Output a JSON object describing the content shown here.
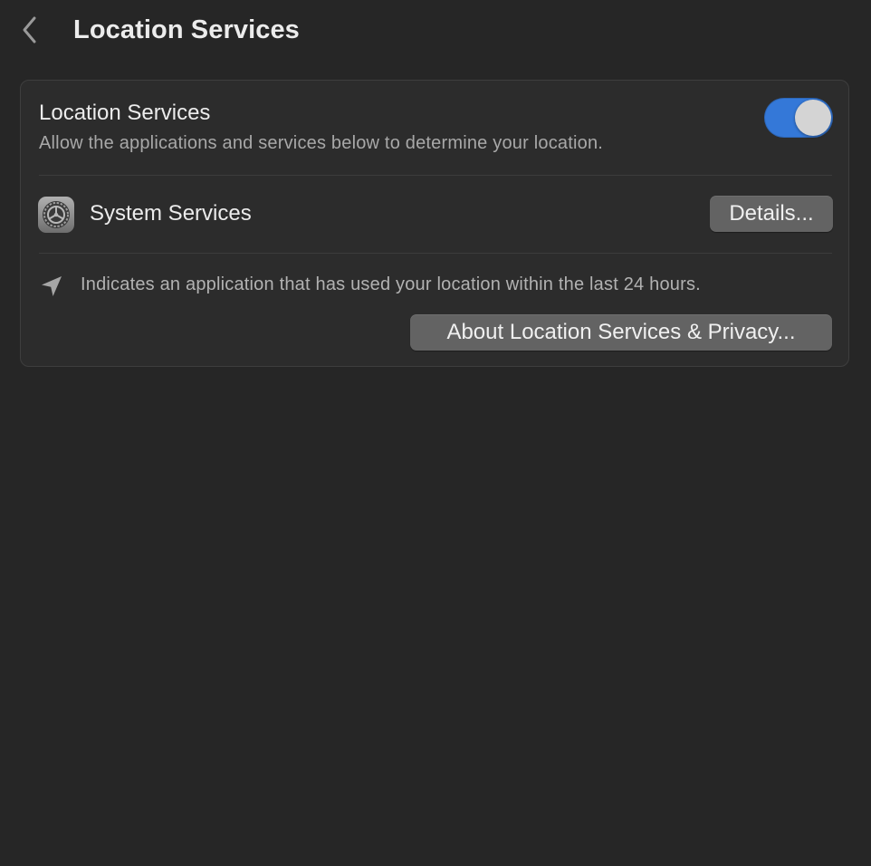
{
  "header": {
    "title": "Location Services",
    "back_icon": "chevron-left-icon"
  },
  "location_services": {
    "title": "Location Services",
    "subtitle": "Allow the applications and services below to determine your location.",
    "enabled": true,
    "toggle_color": "#3478d8"
  },
  "system_services": {
    "icon": "system-settings-gear-icon",
    "label": "System Services",
    "details_label": "Details..."
  },
  "legend": {
    "icon": "location-arrow-icon",
    "text": "Indicates an application that has used your location within the last 24 hours."
  },
  "about_button_label": "About Location Services & Privacy..."
}
